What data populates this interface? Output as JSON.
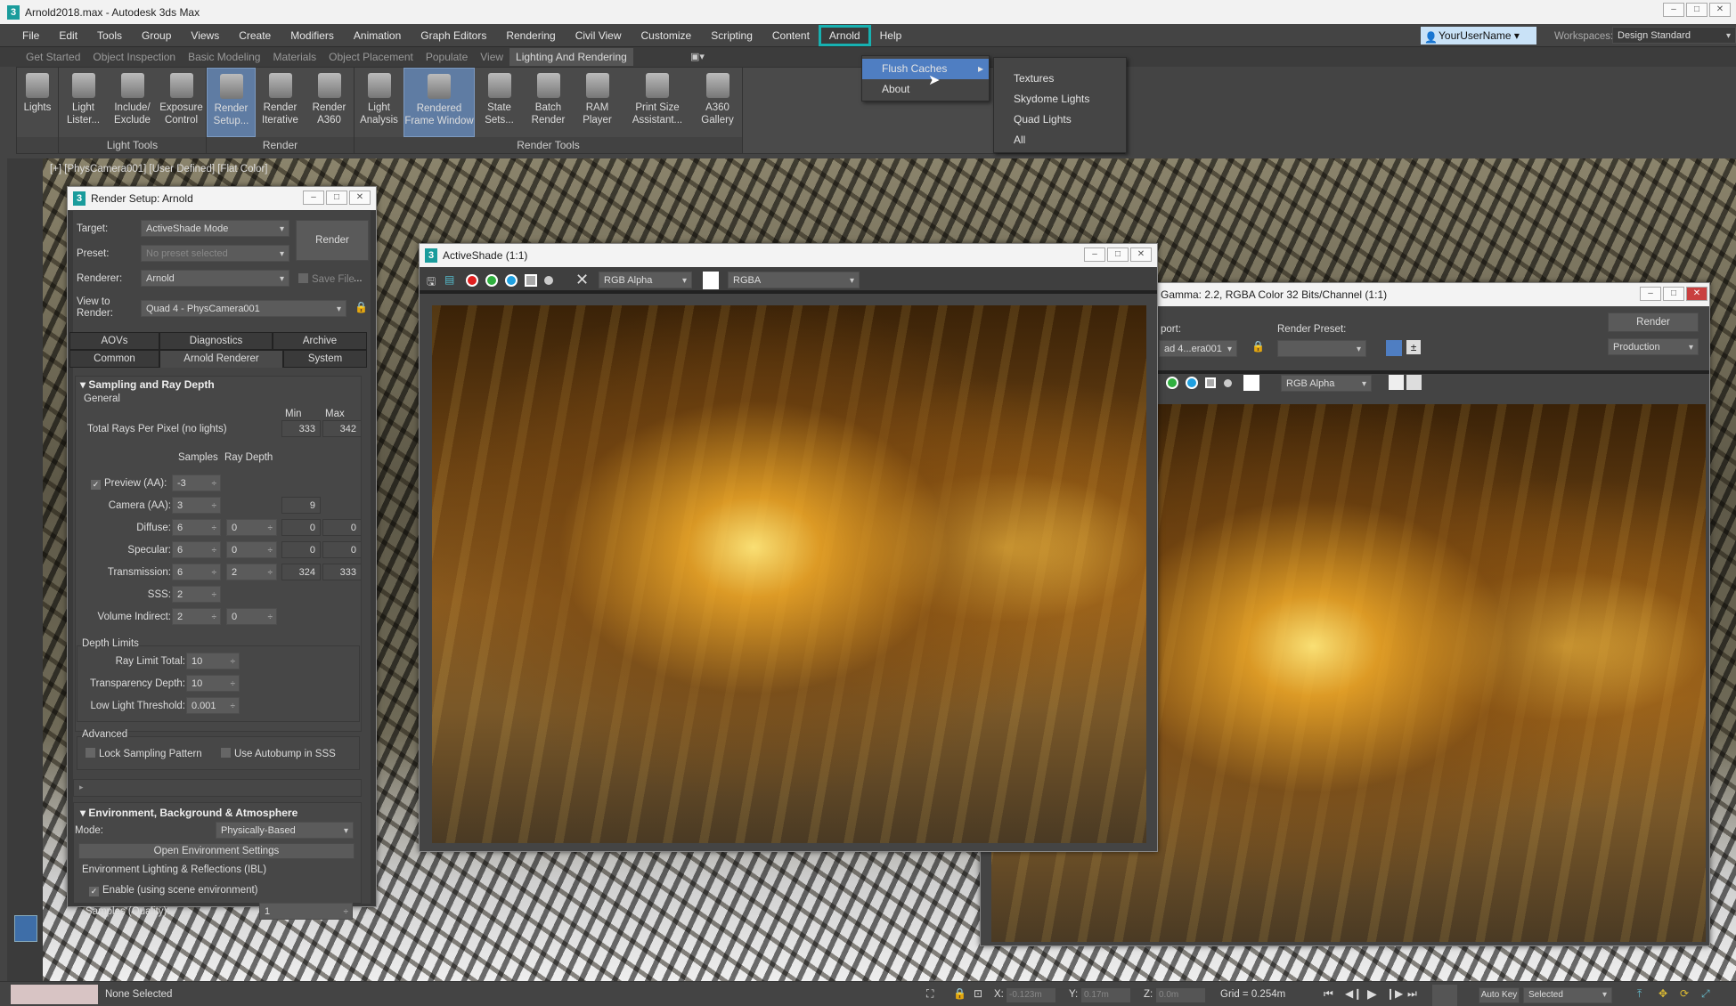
{
  "app": {
    "title": "Arnold2018.max - Autodesk 3ds Max",
    "logo": "3"
  },
  "menubar": {
    "items": [
      "File",
      "Edit",
      "Tools",
      "Group",
      "Views",
      "Create",
      "Modifiers",
      "Animation",
      "Graph Editors",
      "Rendering",
      "Civil View",
      "Customize",
      "Scripting",
      "Content",
      "Arnold",
      "Help"
    ],
    "active": "Arnold",
    "user": "YourUserName",
    "workspaces_label": "Workspaces:",
    "workspace": "Design Standard"
  },
  "ribbon_tabs": {
    "items": [
      "Get Started",
      "Object Inspection",
      "Basic Modeling",
      "Materials",
      "Object Placement",
      "Populate",
      "View",
      "Lighting And Rendering"
    ],
    "active": "Lighting And Rendering"
  },
  "ribbon": {
    "groups": [
      {
        "label": "",
        "buttons": [
          {
            "l1": "Lights",
            "l2": "",
            "icon": "lights-icon"
          }
        ]
      },
      {
        "label": "Light Tools",
        "buttons": [
          {
            "l1": "Light",
            "l2": "Lister...",
            "icon": "light-lister-icon"
          },
          {
            "l1": "Include/",
            "l2": "Exclude",
            "icon": "include-exclude-icon"
          },
          {
            "l1": "Exposure",
            "l2": "Control",
            "icon": "exposure-control-icon"
          }
        ]
      },
      {
        "label": "Render",
        "buttons": [
          {
            "l1": "Render",
            "l2": "Setup...",
            "icon": "render-setup-icon",
            "on": true
          },
          {
            "l1": "Render",
            "l2": "Iterative",
            "icon": "render-iterative-icon"
          },
          {
            "l1": "Render",
            "l2": "A360",
            "icon": "render-a360-icon"
          }
        ]
      },
      {
        "label": "Render Tools",
        "buttons": [
          {
            "l1": "Light",
            "l2": "Analysis",
            "icon": "light-analysis-icon"
          },
          {
            "l1": "Rendered",
            "l2": "Frame Window",
            "icon": "rendered-frame-window-icon",
            "on": true,
            "wide": true
          },
          {
            "l1": "State",
            "l2": "Sets...",
            "icon": "state-sets-icon"
          },
          {
            "l1": "Batch",
            "l2": "Render",
            "icon": "batch-render-icon"
          },
          {
            "l1": "RAM",
            "l2": "Player",
            "icon": "ram-player-icon"
          },
          {
            "l1": "Print Size",
            "l2": "Assistant...",
            "icon": "print-size-icon",
            "wide": true
          },
          {
            "l1": "A360",
            "l2": "Gallery",
            "icon": "a360-gallery-icon"
          }
        ]
      }
    ]
  },
  "arnold_menu": {
    "items": [
      "Flush Caches",
      "About"
    ],
    "highlighted": "Flush Caches",
    "submenu": [
      "Textures",
      "Skydome Lights",
      "Quad Lights",
      "All"
    ]
  },
  "viewport": {
    "label": "[+] [PhysCamera001] [User Defined] [Flat Color]"
  },
  "render_setup": {
    "title": "Render Setup: Arnold",
    "target_label": "Target:",
    "target": "ActiveShade Mode",
    "preset_label": "Preset:",
    "preset": "No preset selected",
    "renderer_label": "Renderer:",
    "renderer": "Arnold",
    "save_file": "Save File",
    "more": "...",
    "view_label1": "View to",
    "view_label2": "Render:",
    "view": "Quad 4 - PhysCamera001",
    "render_button": "Render",
    "tabs_row1": [
      "AOVs",
      "Diagnostics",
      "Archive"
    ],
    "tabs_row2": [
      "Common",
      "Arnold Renderer",
      "System"
    ],
    "active_tab": "Arnold Renderer",
    "sampling": {
      "title": "Sampling and Ray Depth",
      "general": "General",
      "min": "Min",
      "max": "Max",
      "total_label": "Total Rays Per Pixel (no lights)",
      "total_min": "333",
      "total_max": "342",
      "samples_hdr": "Samples",
      "raydepth_hdr": "Ray Depth",
      "rows": [
        {
          "label": "Preview (AA):",
          "samples": "-3",
          "depth": "",
          "min": "",
          "max": "",
          "checked": true
        },
        {
          "label": "Camera (AA):",
          "samples": "3",
          "depth": "",
          "min": "9",
          "max": ""
        },
        {
          "label": "Diffuse:",
          "samples": "6",
          "depth": "0",
          "min": "0",
          "max": "0"
        },
        {
          "label": "Specular:",
          "samples": "6",
          "depth": "0",
          "min": "0",
          "max": "0"
        },
        {
          "label": "Transmission:",
          "samples": "6",
          "depth": "2",
          "min": "324",
          "max": "333"
        },
        {
          "label": "SSS:",
          "samples": "2",
          "depth": "",
          "min": "",
          "max": ""
        },
        {
          "label": "Volume Indirect:",
          "samples": "2",
          "depth": "0",
          "min": "",
          "max": ""
        }
      ]
    },
    "depth_limits": {
      "title": "Depth Limits",
      "rows": [
        {
          "label": "Ray Limit Total:",
          "value": "10"
        },
        {
          "label": "Transparency Depth:",
          "value": "10"
        },
        {
          "label": "Low Light Threshold:",
          "value": "0.001"
        }
      ]
    },
    "advanced": {
      "title": "Advanced",
      "lock": "Lock Sampling Pattern",
      "autobump": "Use Autobump in SSS"
    },
    "environment": {
      "title": "Environment, Background & Atmosphere",
      "mode_label": "Mode:",
      "mode": "Physically-Based",
      "open_button": "Open Environment Settings",
      "ibl_title": "Environment Lighting & Reflections (IBL)",
      "enable": "Enable (using scene environment)",
      "samples_label": "Samples (Quality):",
      "samples": "1"
    }
  },
  "activeshade": {
    "title": "ActiveShade (1:1)",
    "channel": "RGB Alpha",
    "display": "RGBA",
    "channel_colors": [
      "#e02020",
      "#30b040",
      "#20a0e0"
    ]
  },
  "frame_window": {
    "title": "Gamma: 2.2, RGBA Color 32 Bits/Channel (1:1)",
    "viewport_label": "port:",
    "viewport": "ad 4...era001",
    "preset_label": "Render Preset:",
    "preset": "",
    "render_button": "Render",
    "mode": "Production",
    "channel": "RGB Alpha"
  },
  "statusbar": {
    "selection": "None Selected",
    "x_label": "X:",
    "x": "-0.123m",
    "y_label": "Y:",
    "y": "0.17m",
    "z_label": "Z:",
    "z": "0.0m",
    "grid": "Grid = 0.254m",
    "autokey": "Auto Key",
    "key_mode": "Selected"
  },
  "colors": {
    "accent": "#17b1b1",
    "highlight": "#4f7ec2",
    "panel": "#444444"
  }
}
